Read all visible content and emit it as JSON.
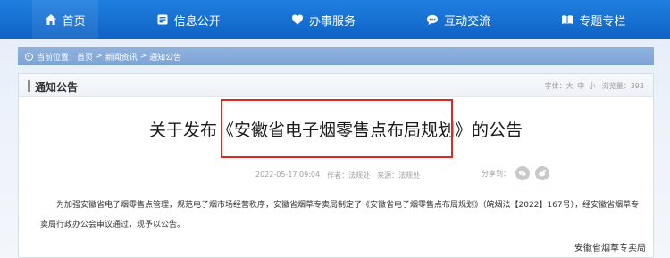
{
  "nav": {
    "items": [
      {
        "label": "首页",
        "icon": "home-icon"
      },
      {
        "label": "信息公开",
        "icon": "document-icon"
      },
      {
        "label": "办事服务",
        "icon": "heart-icon"
      },
      {
        "label": "互动交流",
        "icon": "chat-icon"
      },
      {
        "label": "专题专栏",
        "icon": "book-icon"
      }
    ]
  },
  "breadcrumb": {
    "prefix": "当前位置：",
    "items": [
      "首页",
      "新闻资讯",
      "通知公告"
    ],
    "separator": ">"
  },
  "panel": {
    "title": "通知公告",
    "font_label": "字体：",
    "font_sizes": "大 中 小",
    "views_label": "浏览量：",
    "views": "393"
  },
  "article": {
    "title": "关于发布《安徽省电子烟零售点布局规划》的公告",
    "date": "2022-05-17 09:04",
    "author_label": "作者：",
    "author": "法规处",
    "source_label": "来源：",
    "source": "法规处",
    "share_label": "分享到：",
    "body": "为加强安徽省电子烟零售点管理，规范电子烟市场经营秩序，安徽省烟草专卖局制定了《安徽省电子烟零售点布局规划》（皖烟法【2022】167号），经安徽省烟草专卖局行政办公会审议通过，现予以公告。",
    "signature": "安徽省烟草专卖局"
  },
  "colors": {
    "nav_bg": "#1470d6",
    "highlight": "#e0281f"
  }
}
